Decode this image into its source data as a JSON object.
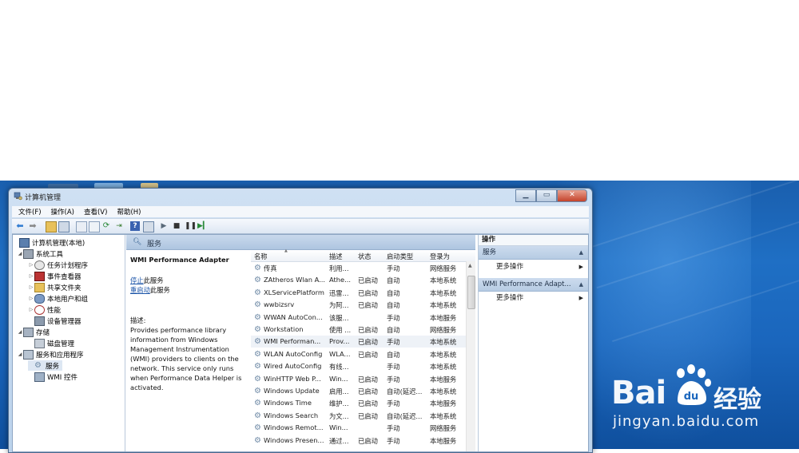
{
  "window": {
    "title": "计算机管理",
    "controls": {
      "minimize": "▁",
      "maximize": "▭",
      "close": "✕"
    }
  },
  "menu": [
    "文件(F)",
    "操作(A)",
    "查看(V)",
    "帮助(H)"
  ],
  "tree": [
    {
      "label": "计算机管理(本地)",
      "level": 0,
      "icon": "computer-icon",
      "expander": ""
    },
    {
      "label": "系统工具",
      "level": 1,
      "icon": "tools-icon",
      "expander": "◢"
    },
    {
      "label": "任务计划程序",
      "level": 2,
      "icon": "clock-icon",
      "expander": "▷"
    },
    {
      "label": "事件查看器",
      "level": 2,
      "icon": "event-icon",
      "expander": "▷"
    },
    {
      "label": "共享文件夹",
      "level": 2,
      "icon": "folder-icon",
      "expander": "▷"
    },
    {
      "label": "本地用户和组",
      "level": 2,
      "icon": "users-icon",
      "expander": "▷"
    },
    {
      "label": "性能",
      "level": 2,
      "icon": "performance-icon",
      "expander": "▷"
    },
    {
      "label": "设备管理器",
      "level": 2,
      "icon": "device-icon",
      "expander": ""
    },
    {
      "label": "存储",
      "level": 1,
      "icon": "storage-icon",
      "expander": "◢"
    },
    {
      "label": "磁盘管理",
      "level": 2,
      "icon": "disk-icon",
      "expander": ""
    },
    {
      "label": "服务和应用程序",
      "level": 1,
      "icon": "services-apps-icon",
      "expander": "◢"
    },
    {
      "label": "服务",
      "level": 2,
      "icon": "gear-icon",
      "expander": ""
    },
    {
      "label": "WMI 控件",
      "level": 2,
      "icon": "wmi-icon",
      "expander": ""
    }
  ],
  "panel": {
    "title": "服务",
    "selected_service": "WMI Performance Adapter",
    "stop_link": "停止",
    "stop_suffix": "此服务",
    "restart_link": "重启动",
    "restart_suffix": "此服务",
    "desc_label": "描述:",
    "desc_text": "Provides performance library information from Windows Management Instrumentation (WMI) providers to clients on the network. This service only runs when Performance Data Helper is activated."
  },
  "columns": [
    "名称",
    "描述",
    "状态",
    "启动类型",
    "登录为"
  ],
  "services": [
    {
      "name": "传真",
      "desc": "利用...",
      "status": "",
      "startup": "手动",
      "logon": "网络服务"
    },
    {
      "name": "ZAtheros Wlan A...",
      "desc": "Athe...",
      "status": "已启动",
      "startup": "自动",
      "logon": "本地系统"
    },
    {
      "name": "XLServicePlatform",
      "desc": "迅雷...",
      "status": "已启动",
      "startup": "自动",
      "logon": "本地系统"
    },
    {
      "name": "wwbizsrv",
      "desc": "为阿...",
      "status": "已启动",
      "startup": "自动",
      "logon": "本地系统"
    },
    {
      "name": "WWAN AutoCon...",
      "desc": "该服...",
      "status": "",
      "startup": "手动",
      "logon": "本地服务"
    },
    {
      "name": "Workstation",
      "desc": "使用 ...",
      "status": "已启动",
      "startup": "自动",
      "logon": "网络服务"
    },
    {
      "name": "WMI Performan...",
      "desc": "Prov...",
      "status": "已启动",
      "startup": "手动",
      "logon": "本地系统"
    },
    {
      "name": "WLAN AutoConfig",
      "desc": "WLA...",
      "status": "已启动",
      "startup": "自动",
      "logon": "本地系统"
    },
    {
      "name": "Wired AutoConfig",
      "desc": "有线...",
      "status": "",
      "startup": "手动",
      "logon": "本地系统"
    },
    {
      "name": "WinHTTP Web P...",
      "desc": "Win...",
      "status": "已启动",
      "startup": "手动",
      "logon": "本地服务"
    },
    {
      "name": "Windows Update",
      "desc": "启用...",
      "status": "已启动",
      "startup": "自动(延迟...",
      "logon": "本地系统"
    },
    {
      "name": "Windows Time",
      "desc": "维护...",
      "status": "已启动",
      "startup": "手动",
      "logon": "本地服务"
    },
    {
      "name": "Windows Search",
      "desc": "为文...",
      "status": "已启动",
      "startup": "自动(延迟...",
      "logon": "本地系统"
    },
    {
      "name": "Windows Remot...",
      "desc": "Win...",
      "status": "",
      "startup": "手动",
      "logon": "网络服务"
    },
    {
      "name": "Windows Presen...",
      "desc": "通过...",
      "status": "已启动",
      "startup": "手动",
      "logon": "本地服务"
    }
  ],
  "actions": {
    "title": "操作",
    "section1": "服务",
    "section1_item": "更多操作",
    "section2": "WMI Performance Adapt...",
    "section2_item": "更多操作"
  },
  "watermark": {
    "brand_latin": "Bai",
    "brand_paw": "du",
    "brand_cn": "经验",
    "url": "jingyan.baidu.com"
  },
  "colors": {
    "desktop_blue": "#1a66bd",
    "selection": "#eef2f7",
    "link": "#1c55a8"
  }
}
